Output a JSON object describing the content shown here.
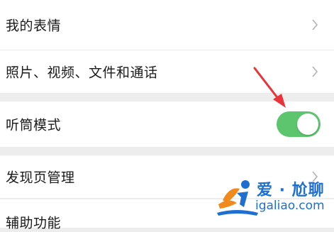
{
  "settings": {
    "items": [
      {
        "label": "我的表情",
        "has_chevron": true
      },
      {
        "label": "照片、视频、文件和通话",
        "has_chevron": true
      },
      {
        "label": "听筒模式",
        "toggle": {
          "on": true,
          "color": "#5cc56d"
        }
      },
      {
        "label": "发现页管理",
        "has_chevron": true
      },
      {
        "label": "辅助功能",
        "has_chevron": true
      }
    ]
  },
  "annotation": {
    "icon": "red-arrow-icon",
    "color": "#e8343a"
  },
  "watermark": {
    "title": "爱 · 尬聊",
    "url": "igaliao.com",
    "color": "#1f6fd1"
  }
}
